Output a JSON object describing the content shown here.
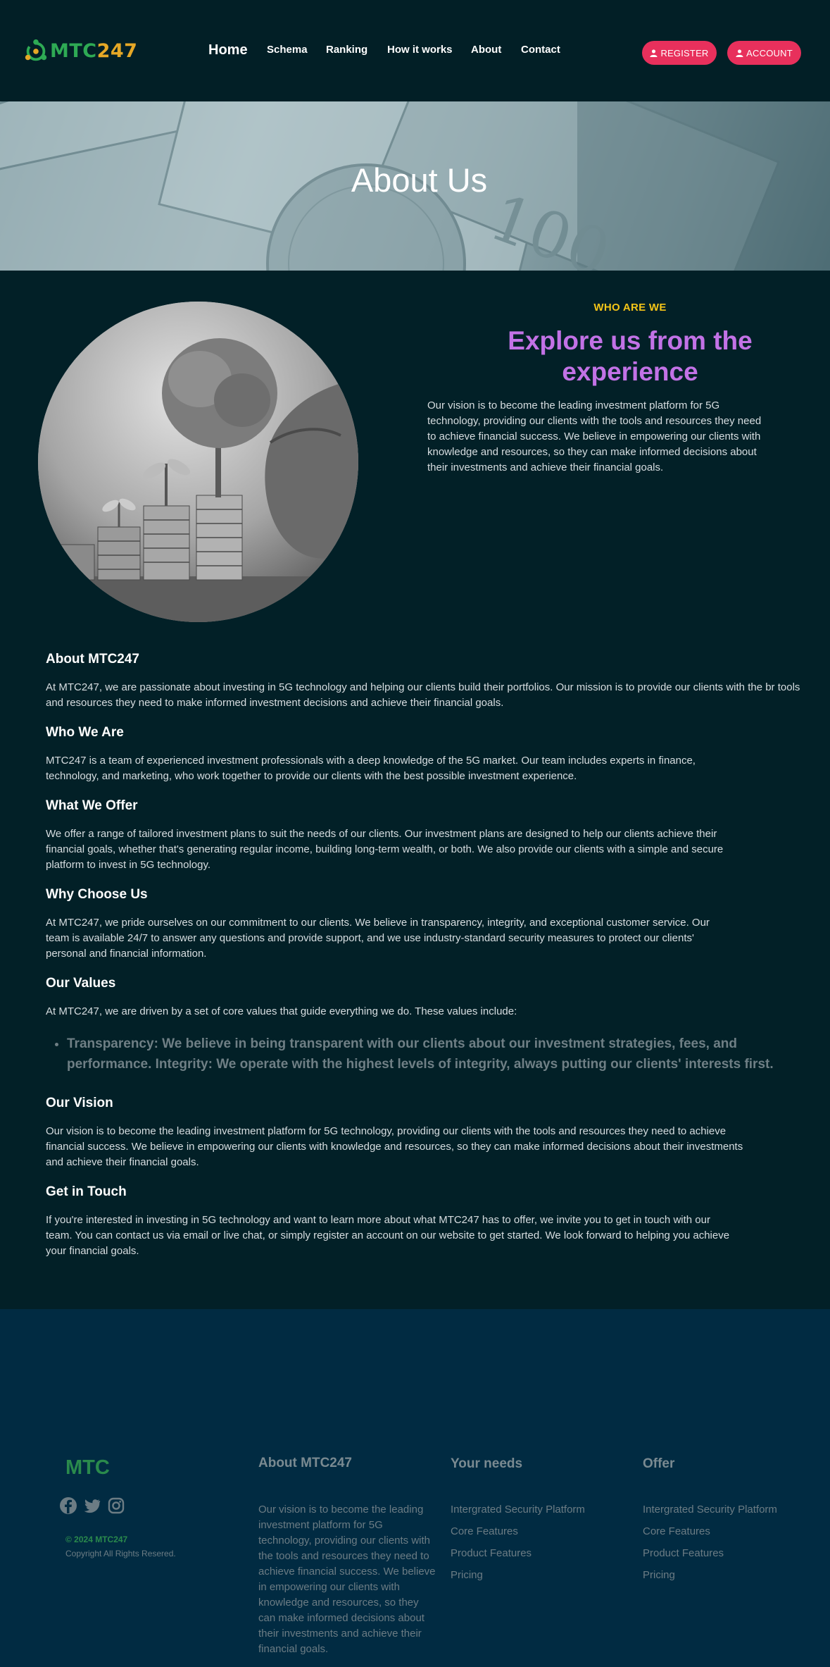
{
  "header": {
    "logo_text_main": "MTC",
    "logo_text_accent": "247",
    "nav": [
      "Home",
      "Schema",
      "Ranking",
      "How it works",
      "About",
      "Contact"
    ],
    "register_label": "REGISTER",
    "account_label": "ACCOUNT",
    "colors": {
      "background": "#021f26",
      "button": "#e8305c",
      "logo_green": "#2eaa54",
      "logo_orange": "#e6a826"
    }
  },
  "hero": {
    "title": "About Us"
  },
  "intro": {
    "eyebrow": "WHO ARE WE",
    "heading": "Explore us from the experience",
    "text": "Our vision is to become the leading investment platform for 5G technology, providing our clients with the tools and resources they need to achieve financial success. We believe in empowering our clients with knowledge and resources, so they can make informed decisions about their investments and achieve their financial goals.",
    "colors": {
      "eyebrow": "#f5c518",
      "heading": "#c272e6"
    }
  },
  "sections": [
    {
      "title": "About MTC247",
      "text": "At MTC247, we are passionate about investing in 5G technology and helping our clients build their portfolios. Our mission is to provide our clients with the br tools and resources they need to make informed investment decisions and achieve their financial goals."
    },
    {
      "title": "Who We Are",
      "text": "MTC247 is a team of experienced investment professionals with a deep knowledge of the 5G market. Our team includes experts in finance, technology, and marketing, who work together to provide our clients with the best possible investment experience."
    },
    {
      "title": "What We Offer",
      "text": "We offer a range of tailored investment plans to suit the needs of our clients. Our investment plans are designed to help our clients achieve their financial goals, whether that's generating regular income, building long-term wealth, or both. We also provide our clients with a simple and secure platform to invest in 5G technology."
    },
    {
      "title": "Why Choose Us",
      "text": "At MTC247, we pride ourselves on our commitment to our clients. We believe in transparency, integrity, and exceptional customer service. Our team is available 24/7 to answer any questions and provide support, and we use industry-standard security measures to protect our clients' personal and financial information."
    },
    {
      "title": "Our Values",
      "text": "At MTC247, we are driven by a set of core values that guide everything we do. These values include:"
    }
  ],
  "values_list": [
    "Transparency: We believe in being transparent with our clients about our investment strategies, fees, and performance. Integrity: We operate with the highest levels of integrity, always putting our clients' interests first."
  ],
  "sections_after": [
    {
      "title": "Our Vision",
      "text": "Our vision is to become the leading investment platform for 5G technology, providing our clients with the tools and resources they need to achieve financial success. We believe in empowering our clients with knowledge and resources, so they can make informed decisions about their investments and achieve their financial goals."
    },
    {
      "title": "Get in Touch",
      "text": "If you're interested in investing in 5G technology and want to learn more about what MTC247 has to offer, we invite you to get in touch with our team. You can contact us via email or live chat, or simply register an account on our website to get started. We look forward to helping you achieve your financial goals."
    }
  ],
  "footer": {
    "brand": "MTC",
    "socials": [
      "facebook-icon",
      "twitter-icon",
      "instagram-icon"
    ],
    "copyright_year": "© 2024 MTC247",
    "copyright_text": "Copyright All Rights Resered.",
    "about_title": "About MTC247",
    "about_text": "Our vision is to become the leading investment platform for 5G technology, providing our clients with the tools and resources they need to achieve financial success. We believe in empowering our clients with knowledge and resources, so they can make informed decisions about their investments and achieve their financial goals.",
    "needs_title": "Your needs",
    "needs_items": [
      "Intergrated Security Platform",
      "Core Features",
      "Product Features",
      "Pricing"
    ],
    "offer_title": "Offer",
    "offer_items": [
      "Intergrated Security Platform",
      "Core Features",
      "Product Features",
      "Pricing"
    ],
    "colors": {
      "background": "#012b42",
      "brand": "#2a8a4c"
    }
  }
}
